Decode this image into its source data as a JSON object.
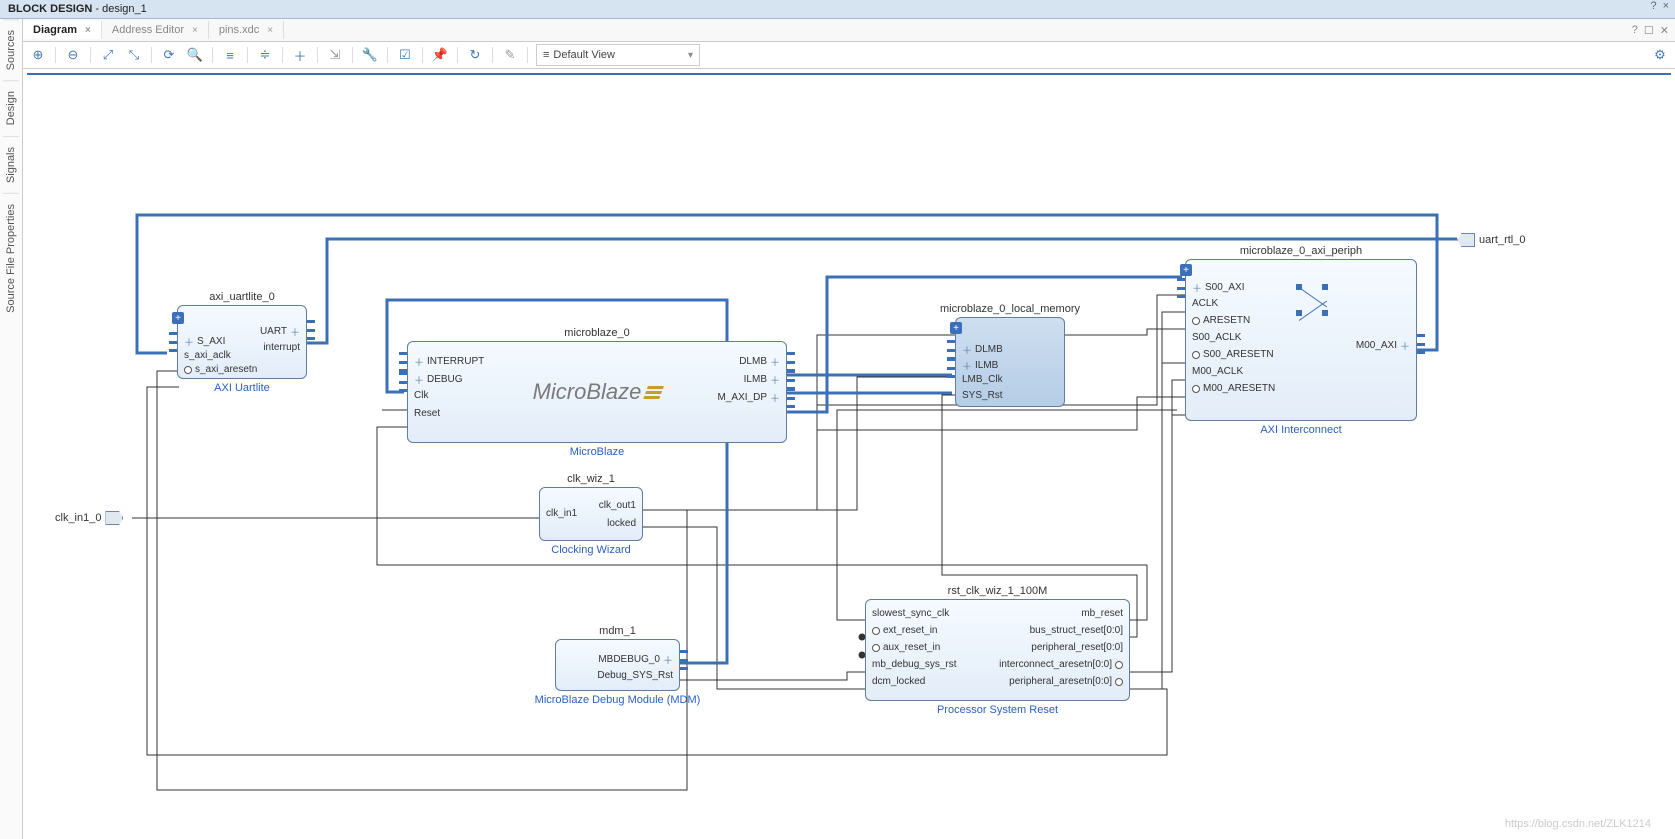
{
  "window": {
    "title_prefix": "BLOCK DESIGN",
    "title_suffix": " - design_1",
    "help": "?",
    "close": "×"
  },
  "side_tabs": [
    "Sources",
    "Design",
    "Signals",
    "Source File Properties"
  ],
  "tabs": [
    {
      "label": "Diagram",
      "active": true
    },
    {
      "label": "Address Editor",
      "active": false
    },
    {
      "label": "pins.xdc",
      "active": false
    }
  ],
  "tabbar_icons": {
    "help": "?",
    "max": "☐",
    "close": "✕"
  },
  "toolbar": {
    "zoom_in": "⊕",
    "zoom_out": "⊖",
    "fit": "⤢",
    "fit_sel": "⤡",
    "refresh": "⟳",
    "search": "🔍",
    "hcenter": "≡",
    "vcenter": "≑",
    "add": "＋",
    "link": "⇲",
    "wrench": "🔧",
    "check": "☑",
    "pin": "📌",
    "redo": "↻",
    "stamp": "✎",
    "gear": "⚙",
    "view_icon": "≡",
    "view_label": "Default View"
  },
  "ext_ports": {
    "clk_in": "clk_in1_0",
    "uart": "uart_rtl_0"
  },
  "blocks": {
    "uart": {
      "name": "axi_uartlite_0",
      "sub": "AXI Uartlite",
      "pins_l": [
        "S_AXI",
        "s_axi_aclk",
        "s_axi_aresetn"
      ],
      "pins_r": [
        "UART",
        "interrupt"
      ]
    },
    "mb": {
      "name": "microblaze_0",
      "sub": "MicroBlaze",
      "pins_l": [
        "INTERRUPT",
        "DEBUG",
        "Clk",
        "Reset"
      ],
      "pins_r": [
        "DLMB",
        "ILMB",
        "M_AXI_DP"
      ]
    },
    "mem": {
      "name": "microblaze_0_local_memory",
      "pins_l": [
        "DLMB",
        "ILMB",
        "LMB_Clk",
        "SYS_Rst"
      ]
    },
    "clk": {
      "name": "clk_wiz_1",
      "sub": "Clocking Wizard",
      "pins_l": [
        "clk_in1"
      ],
      "pins_r": [
        "clk_out1",
        "locked"
      ]
    },
    "mdm": {
      "name": "mdm_1",
      "sub": "MicroBlaze Debug Module (MDM)",
      "pins_r": [
        "MBDEBUG_0",
        "Debug_SYS_Rst"
      ]
    },
    "rst": {
      "name": "rst_clk_wiz_1_100M",
      "sub": "Processor System Reset",
      "pins_l": [
        "slowest_sync_clk",
        "ext_reset_in",
        "aux_reset_in",
        "mb_debug_sys_rst",
        "dcm_locked"
      ],
      "pins_r": [
        "mb_reset",
        "bus_struct_reset[0:0]",
        "peripheral_reset[0:0]",
        "interconnect_aresetn[0:0]",
        "peripheral_aresetn[0:0]"
      ]
    },
    "interc": {
      "name": "microblaze_0_axi_periph",
      "sub": "AXI Interconnect",
      "pins_l": [
        "S00_AXI",
        "ACLK",
        "ARESETN",
        "S00_ACLK",
        "S00_ARESETN",
        "M00_ACLK",
        "M00_ARESETN"
      ],
      "pins_r": [
        "M00_AXI"
      ]
    }
  },
  "logo_text": "MicroBlaze",
  "watermark": "https://blog.csdn.net/ZLK1214"
}
